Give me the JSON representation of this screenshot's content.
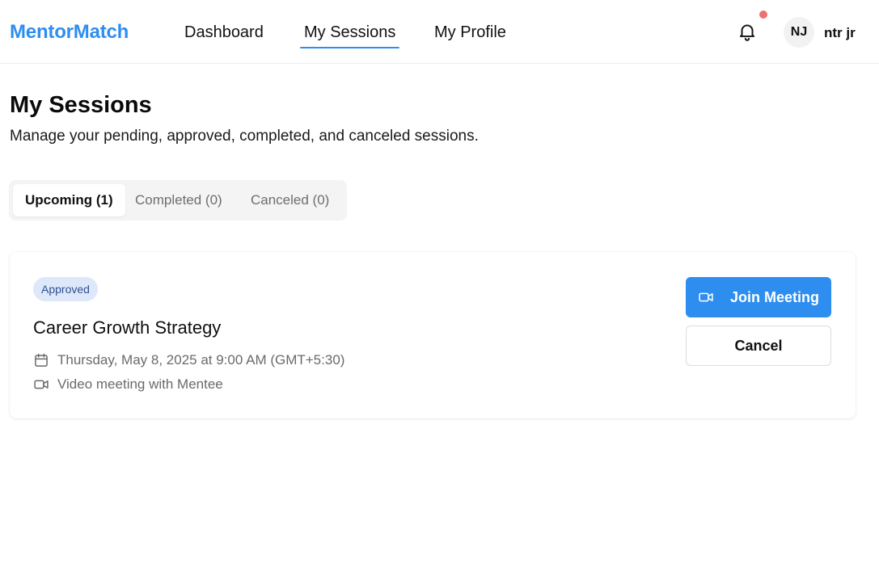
{
  "header": {
    "brand": "MentorMatch",
    "nav": [
      {
        "label": "Dashboard",
        "active": false
      },
      {
        "label": "My Sessions",
        "active": true
      },
      {
        "label": "My Profile",
        "active": false
      }
    ],
    "notifications": {
      "icon": "bell-icon",
      "has_unread": true
    },
    "user": {
      "initials": "NJ",
      "name": "ntr jr"
    }
  },
  "page": {
    "title": "My Sessions",
    "subtitle": "Manage your pending, approved, completed, and canceled sessions."
  },
  "tabs": [
    {
      "label": "Upcoming (1)",
      "active": true
    },
    {
      "label": "Completed (0)",
      "active": false
    },
    {
      "label": "Canceled (0)",
      "active": false
    }
  ],
  "sessions": [
    {
      "status": "Approved",
      "title": "Career Growth Strategy",
      "datetime": "Thursday, May 8, 2025 at 9:00 AM (GMT+5:30)",
      "datetime_icon": "calendar-icon",
      "meeting_info": "Video meeting with Mentee",
      "meeting_icon": "video-icon",
      "join_label": "Join Meeting",
      "cancel_label": "Cancel"
    }
  ],
  "colors": {
    "accent": "#2d8ef0",
    "badge_bg": "#dde9fb",
    "badge_text": "#2f4f8f",
    "notification_dot": "#f07070"
  }
}
